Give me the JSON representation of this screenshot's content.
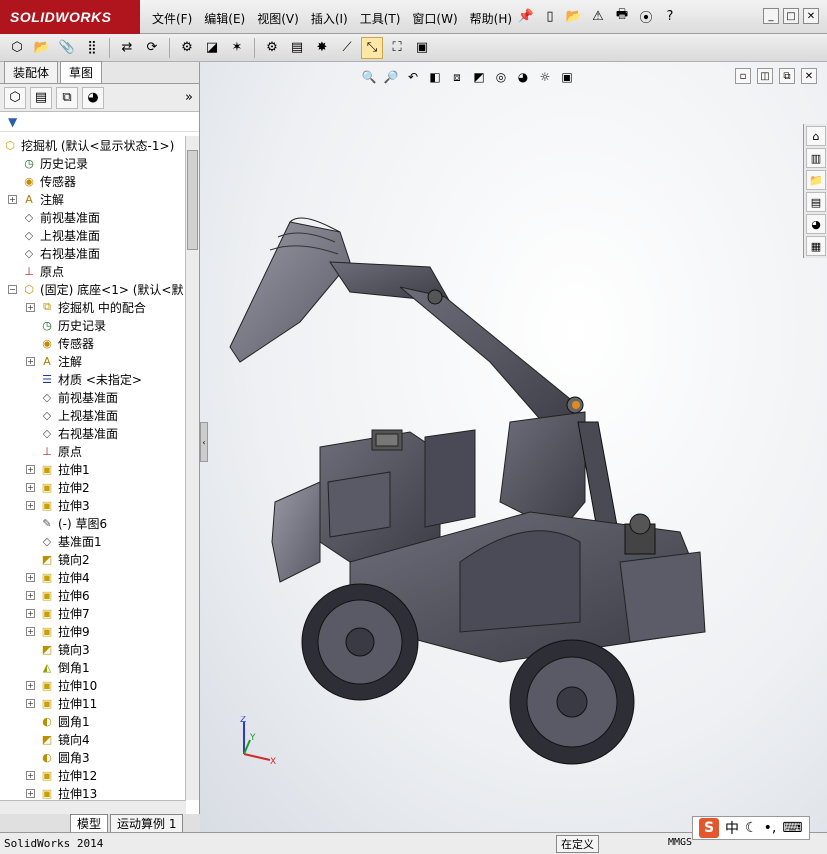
{
  "app": {
    "logo_text": "SOLIDWORKS",
    "brand_color": "#b0151e"
  },
  "menu": [
    "文件(F)",
    "编辑(E)",
    "视图(V)",
    "插入(I)",
    "工具(T)",
    "窗口(W)",
    "帮助(H)"
  ],
  "left_panel": {
    "top_tabs": [
      "装配体",
      "草图"
    ],
    "root_label": "挖掘机 (默认<显示状态-1>)",
    "tree": [
      {
        "label": "历史记录",
        "level": 1,
        "icon": "history-icon",
        "expand": ""
      },
      {
        "label": "传感器",
        "level": 1,
        "icon": "sensor-icon",
        "expand": ""
      },
      {
        "label": "注解",
        "level": 1,
        "icon": "annotation-icon",
        "expand": "+"
      },
      {
        "label": "前视基准面",
        "level": 1,
        "icon": "plane-icon",
        "expand": ""
      },
      {
        "label": "上视基准面",
        "level": 1,
        "icon": "plane-icon",
        "expand": ""
      },
      {
        "label": "右视基准面",
        "level": 1,
        "icon": "plane-icon",
        "expand": ""
      },
      {
        "label": "原点",
        "level": 1,
        "icon": "origin-icon",
        "expand": ""
      },
      {
        "label": "(固定) 底座<1> (默认<默",
        "level": 1,
        "icon": "part-icon",
        "expand": "−"
      },
      {
        "label": "挖掘机 中的配合",
        "level": 2,
        "icon": "mates-icon",
        "expand": "+"
      },
      {
        "label": "历史记录",
        "level": 2,
        "icon": "history-icon",
        "expand": ""
      },
      {
        "label": "传感器",
        "level": 2,
        "icon": "sensor-icon",
        "expand": ""
      },
      {
        "label": "注解",
        "level": 2,
        "icon": "annotation-icon",
        "expand": "+"
      },
      {
        "label": "材质 <未指定>",
        "level": 2,
        "icon": "material-icon",
        "expand": ""
      },
      {
        "label": "前视基准面",
        "level": 2,
        "icon": "plane-icon",
        "expand": ""
      },
      {
        "label": "上视基准面",
        "level": 2,
        "icon": "plane-icon",
        "expand": ""
      },
      {
        "label": "右视基准面",
        "level": 2,
        "icon": "plane-icon",
        "expand": ""
      },
      {
        "label": "原点",
        "level": 2,
        "icon": "origin-icon",
        "expand": ""
      },
      {
        "label": "拉伸1",
        "level": 2,
        "icon": "extrude-icon",
        "expand": "+"
      },
      {
        "label": "拉伸2",
        "level": 2,
        "icon": "extrude-icon",
        "expand": "+"
      },
      {
        "label": "拉伸3",
        "level": 2,
        "icon": "extrude-icon",
        "expand": "+"
      },
      {
        "label": "(-) 草图6",
        "level": 2,
        "icon": "sketch-icon",
        "expand": ""
      },
      {
        "label": "基准面1",
        "level": 2,
        "icon": "plane-icon",
        "expand": ""
      },
      {
        "label": "镜向2",
        "level": 2,
        "icon": "mirror-icon",
        "expand": ""
      },
      {
        "label": "拉伸4",
        "level": 2,
        "icon": "extrude-icon",
        "expand": "+"
      },
      {
        "label": "拉伸6",
        "level": 2,
        "icon": "extrude-icon",
        "expand": "+"
      },
      {
        "label": "拉伸7",
        "level": 2,
        "icon": "extrude-icon",
        "expand": "+"
      },
      {
        "label": "拉伸9",
        "level": 2,
        "icon": "extrude-icon",
        "expand": "+"
      },
      {
        "label": "镜向3",
        "level": 2,
        "icon": "mirror-icon",
        "expand": ""
      },
      {
        "label": "倒角1",
        "level": 2,
        "icon": "chamfer-icon",
        "expand": ""
      },
      {
        "label": "拉伸10",
        "level": 2,
        "icon": "extrude-icon",
        "expand": "+"
      },
      {
        "label": "拉伸11",
        "level": 2,
        "icon": "extrude-icon",
        "expand": "+"
      },
      {
        "label": "圆角1",
        "level": 2,
        "icon": "fillet-icon",
        "expand": ""
      },
      {
        "label": "镜向4",
        "level": 2,
        "icon": "mirror-icon",
        "expand": ""
      },
      {
        "label": "圆角3",
        "level": 2,
        "icon": "fillet-icon",
        "expand": ""
      },
      {
        "label": "拉伸12",
        "level": 2,
        "icon": "extrude-icon",
        "expand": "+"
      },
      {
        "label": "拉伸13",
        "level": 2,
        "icon": "extrude-icon",
        "expand": "+"
      }
    ],
    "bottom_tabs": [
      "模型",
      "运动算例 1"
    ]
  },
  "viewport": {
    "triad": {
      "z": "Z",
      "y": "Y",
      "x": "X"
    }
  },
  "statusbar": {
    "left": "SolidWorks 2014",
    "edit_label": "在定义",
    "units": "MMGS"
  },
  "ime": {
    "lang": "中"
  }
}
